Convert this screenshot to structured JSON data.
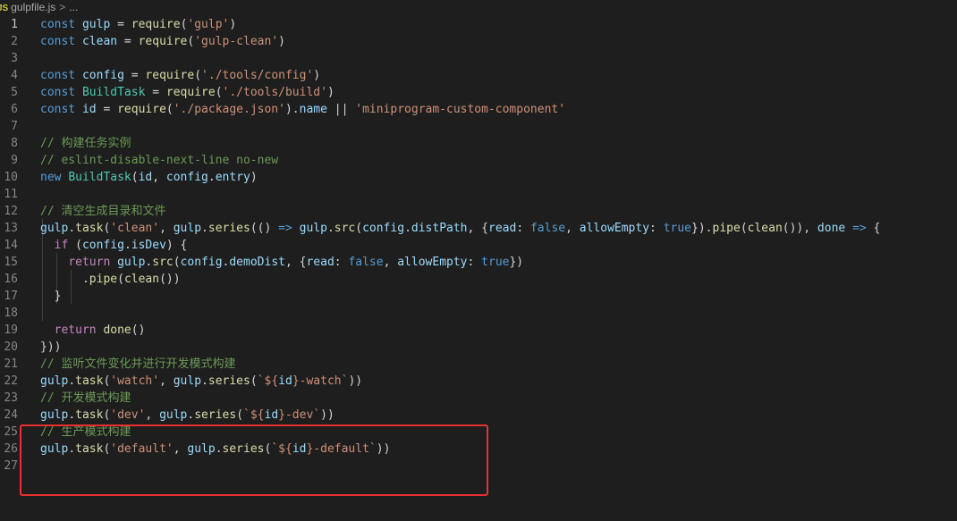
{
  "breadcrumb": {
    "icon_label": "JS",
    "file_name": "gulpfile.js",
    "separator": ">",
    "more": "..."
  },
  "editor": {
    "active_line": 1,
    "line_numbers": [
      "1",
      "2",
      "3",
      "4",
      "5",
      "6",
      "7",
      "8",
      "9",
      "10",
      "11",
      "12",
      "13",
      "14",
      "15",
      "16",
      "17",
      "18",
      "19",
      "20",
      "21",
      "22",
      "23",
      "24",
      "25",
      "26",
      "27"
    ],
    "lines": [
      [
        [
          "kw",
          "const "
        ],
        [
          "id",
          "gulp"
        ],
        [
          "op",
          " = "
        ],
        [
          "fn",
          "require"
        ],
        [
          "pn",
          "("
        ],
        [
          "str",
          "'gulp'"
        ],
        [
          "pn",
          ")"
        ]
      ],
      [
        [
          "kw",
          "const "
        ],
        [
          "id",
          "clean"
        ],
        [
          "op",
          " = "
        ],
        [
          "fn",
          "require"
        ],
        [
          "pn",
          "("
        ],
        [
          "str",
          "'gulp-clean'"
        ],
        [
          "pn",
          ")"
        ]
      ],
      [],
      [
        [
          "kw",
          "const "
        ],
        [
          "id",
          "config"
        ],
        [
          "op",
          " = "
        ],
        [
          "fn",
          "require"
        ],
        [
          "pn",
          "("
        ],
        [
          "str",
          "'./tools/config'"
        ],
        [
          "pn",
          ")"
        ]
      ],
      [
        [
          "kw",
          "const "
        ],
        [
          "cls",
          "BuildTask"
        ],
        [
          "op",
          " = "
        ],
        [
          "fn",
          "require"
        ],
        [
          "pn",
          "("
        ],
        [
          "str",
          "'./tools/build'"
        ],
        [
          "pn",
          ")"
        ]
      ],
      [
        [
          "kw",
          "const "
        ],
        [
          "id",
          "id"
        ],
        [
          "op",
          " = "
        ],
        [
          "fn",
          "require"
        ],
        [
          "pn",
          "("
        ],
        [
          "str",
          "'./package.json'"
        ],
        [
          "pn",
          ")."
        ],
        [
          "id",
          "name"
        ],
        [
          "op",
          " || "
        ],
        [
          "str",
          "'miniprogram-custom-component'"
        ]
      ],
      [],
      [
        [
          "cm",
          "// 构建任务实例"
        ]
      ],
      [
        [
          "cm",
          "// eslint-disable-next-line no-new"
        ]
      ],
      [
        [
          "kw",
          "new "
        ],
        [
          "cls",
          "BuildTask"
        ],
        [
          "pn",
          "("
        ],
        [
          "id",
          "id"
        ],
        [
          "pn",
          ", "
        ],
        [
          "id",
          "config"
        ],
        [
          "pn",
          "."
        ],
        [
          "id",
          "entry"
        ],
        [
          "pn",
          ")"
        ]
      ],
      [],
      [
        [
          "cm",
          "// 清空生成目录和文件"
        ]
      ],
      [
        [
          "id",
          "gulp"
        ],
        [
          "pn",
          "."
        ],
        [
          "fn",
          "task"
        ],
        [
          "pn",
          "("
        ],
        [
          "str",
          "'clean'"
        ],
        [
          "pn",
          ", "
        ],
        [
          "id",
          "gulp"
        ],
        [
          "pn",
          "."
        ],
        [
          "fn",
          "series"
        ],
        [
          "pn",
          "(() "
        ],
        [
          "kw",
          "=>"
        ],
        [
          "pn",
          " "
        ],
        [
          "id",
          "gulp"
        ],
        [
          "pn",
          "."
        ],
        [
          "fn",
          "src"
        ],
        [
          "pn",
          "("
        ],
        [
          "id",
          "config"
        ],
        [
          "pn",
          "."
        ],
        [
          "id",
          "distPath"
        ],
        [
          "pn",
          ", {"
        ],
        [
          "id",
          "read"
        ],
        [
          "pn",
          ": "
        ],
        [
          "kw",
          "false"
        ],
        [
          "pn",
          ", "
        ],
        [
          "id",
          "allowEmpty"
        ],
        [
          "pn",
          ": "
        ],
        [
          "kw",
          "true"
        ],
        [
          "pn",
          "})."
        ],
        [
          "fn",
          "pipe"
        ],
        [
          "pn",
          "("
        ],
        [
          "fn",
          "clean"
        ],
        [
          "pn",
          "()), "
        ],
        [
          "id",
          "done"
        ],
        [
          "pn",
          " "
        ],
        [
          "kw",
          "=>"
        ],
        [
          "pn",
          " {"
        ]
      ],
      [
        [
          "pn",
          "  "
        ],
        [
          "ctl",
          "if"
        ],
        [
          "pn",
          " ("
        ],
        [
          "id",
          "config"
        ],
        [
          "pn",
          "."
        ],
        [
          "id",
          "isDev"
        ],
        [
          "pn",
          ") {"
        ]
      ],
      [
        [
          "pn",
          "    "
        ],
        [
          "ctl",
          "return"
        ],
        [
          "pn",
          " "
        ],
        [
          "id",
          "gulp"
        ],
        [
          "pn",
          "."
        ],
        [
          "fn",
          "src"
        ],
        [
          "pn",
          "("
        ],
        [
          "id",
          "config"
        ],
        [
          "pn",
          "."
        ],
        [
          "id",
          "demoDist"
        ],
        [
          "pn",
          ", {"
        ],
        [
          "id",
          "read"
        ],
        [
          "pn",
          ": "
        ],
        [
          "kw",
          "false"
        ],
        [
          "pn",
          ", "
        ],
        [
          "id",
          "allowEmpty"
        ],
        [
          "pn",
          ": "
        ],
        [
          "kw",
          "true"
        ],
        [
          "pn",
          "})"
        ]
      ],
      [
        [
          "pn",
          "      ."
        ],
        [
          "fn",
          "pipe"
        ],
        [
          "pn",
          "("
        ],
        [
          "fn",
          "clean"
        ],
        [
          "pn",
          "())"
        ]
      ],
      [
        [
          "pn",
          "  }"
        ]
      ],
      [],
      [
        [
          "pn",
          "  "
        ],
        [
          "ctl",
          "return"
        ],
        [
          "pn",
          " "
        ],
        [
          "fn",
          "done"
        ],
        [
          "pn",
          "()"
        ]
      ],
      [
        [
          "pn",
          "}))"
        ]
      ],
      [
        [
          "cm",
          "// 监听文件变化并进行开发模式构建"
        ]
      ],
      [
        [
          "id",
          "gulp"
        ],
        [
          "pn",
          "."
        ],
        [
          "fn",
          "task"
        ],
        [
          "pn",
          "("
        ],
        [
          "str",
          "'watch'"
        ],
        [
          "pn",
          ", "
        ],
        [
          "id",
          "gulp"
        ],
        [
          "pn",
          "."
        ],
        [
          "fn",
          "series"
        ],
        [
          "pn",
          "("
        ],
        [
          "str",
          "`${"
        ],
        [
          "id",
          "id"
        ],
        [
          "str",
          "}-watch`"
        ],
        [
          "pn",
          "))"
        ]
      ],
      [
        [
          "cm",
          "// 开发模式构建"
        ]
      ],
      [
        [
          "id",
          "gulp"
        ],
        [
          "pn",
          "."
        ],
        [
          "fn",
          "task"
        ],
        [
          "pn",
          "("
        ],
        [
          "str",
          "'dev'"
        ],
        [
          "pn",
          ", "
        ],
        [
          "id",
          "gulp"
        ],
        [
          "pn",
          "."
        ],
        [
          "fn",
          "series"
        ],
        [
          "pn",
          "("
        ],
        [
          "str",
          "`${"
        ],
        [
          "id",
          "id"
        ],
        [
          "str",
          "}-dev`"
        ],
        [
          "pn",
          "))"
        ]
      ],
      [
        [
          "cm",
          "// 生产模式构建"
        ]
      ],
      [
        [
          "id",
          "gulp"
        ],
        [
          "pn",
          "."
        ],
        [
          "fn",
          "task"
        ],
        [
          "pn",
          "("
        ],
        [
          "str",
          "'default'"
        ],
        [
          "pn",
          ", "
        ],
        [
          "id",
          "gulp"
        ],
        [
          "pn",
          "."
        ],
        [
          "fn",
          "series"
        ],
        [
          "pn",
          "("
        ],
        [
          "str",
          "`${"
        ],
        [
          "id",
          "id"
        ],
        [
          "str",
          "}-default`"
        ],
        [
          "pn",
          "))"
        ]
      ],
      []
    ]
  },
  "colors": {
    "background": "#1e1e1e",
    "highlight_border": "#e8312f"
  }
}
